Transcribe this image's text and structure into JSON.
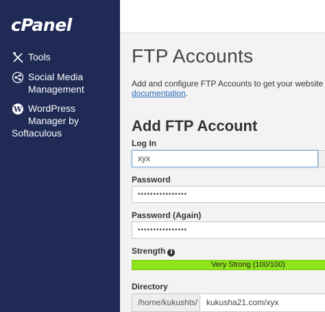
{
  "app": {
    "logo": "cPanel"
  },
  "sidebar": {
    "background": "#1f2a55",
    "items": [
      {
        "label": "Tools",
        "icon": "tools-icon"
      },
      {
        "label": "Social Media Management",
        "line1": "Social Media",
        "line2": "Management",
        "icon": "social-media-icon"
      },
      {
        "label": "WordPress Manager by Softaculous",
        "line1": "WordPress",
        "line2": "Manager by",
        "line3": "Softaculous",
        "icon": "wordpress-icon"
      }
    ]
  },
  "page": {
    "title": "FTP Accounts",
    "description": "Add and configure FTP Accounts to get your website on the",
    "doc_link": "documentation",
    "doc_suffix": "."
  },
  "form": {
    "section_title": "Add FTP Account",
    "login": {
      "label": "Log In",
      "value": "xyx"
    },
    "password": {
      "label": "Password",
      "value": "••••••••••••••••"
    },
    "password_again": {
      "label": "Password (Again)",
      "value": "••••••••••••••••"
    },
    "strength": {
      "label": "Strength",
      "text": "Very Strong (100/100)",
      "value": 100,
      "color": "#8ee31a"
    },
    "directory": {
      "label": "Directory",
      "prefix": "/home/kukushts/",
      "value": "kukusha21.com/xyx"
    }
  }
}
